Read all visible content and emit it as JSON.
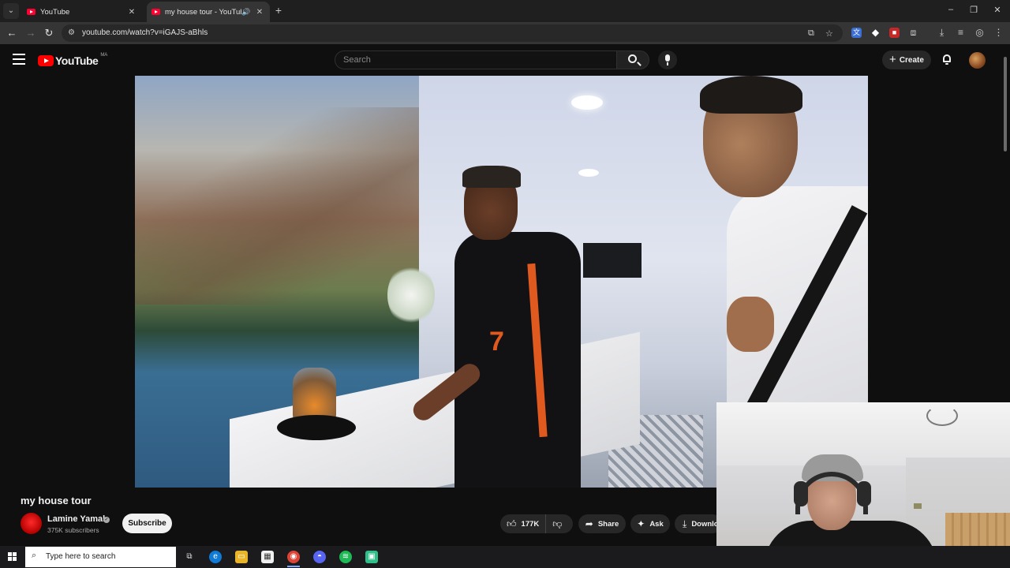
{
  "browser": {
    "tabs": [
      {
        "title": "YouTube",
        "active": false,
        "audio": false
      },
      {
        "title": "my house tour - YouTube",
        "active": true,
        "audio": true
      }
    ],
    "url": "youtube.com/watch?v=iGAJS-aBhls",
    "new_tab_glyph": "+",
    "close_glyph": "✕",
    "minimize_glyph": "–",
    "restore_glyph": "❐",
    "window_close_glyph": "✕",
    "back_glyph": "←",
    "forward_glyph": "→",
    "reload_glyph": "↻",
    "star_glyph": "☆"
  },
  "youtube": {
    "logo_text": "YouTube",
    "country_code": "MA",
    "search_placeholder": "Search",
    "create_label": "Create",
    "create_glyph": "+"
  },
  "video": {
    "title": "my house tour",
    "channel": {
      "name": "Lamine Yamal",
      "subscribers": "375K subscribers",
      "verified_glyph": "✓"
    },
    "subscribe_label": "Subscribe",
    "actions": {
      "likes": "177K",
      "share_label": "Share",
      "ask_label": "Ask",
      "download_label": "Download"
    }
  },
  "taskbar": {
    "search_placeholder": "Type here to search",
    "search_glyph": "⌕"
  },
  "colors": {
    "youtube_red": "#ff0000",
    "page_bg": "#0f0f0f",
    "pill_bg": "#272727"
  }
}
